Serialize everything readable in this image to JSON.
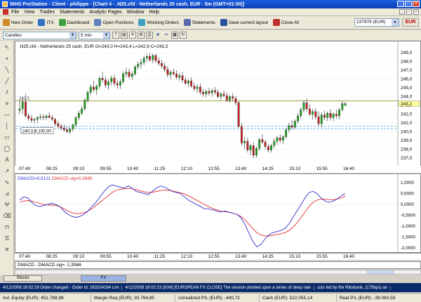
{
  "window": {
    "title": "WHS ProStation - Client - philippe - [Chart 4 - .N25.cfd - Netherlands 25 cash, EUR - 5m (GMT+01:00)]"
  },
  "menu": [
    "File",
    "View",
    "Trades",
    "Statements",
    "Analytic Pages",
    "Window",
    "Help"
  ],
  "toolbar": {
    "items": [
      {
        "label": "New Order",
        "icon": "new-order-icon",
        "color": "#d08a2a"
      },
      {
        "label": "ITX",
        "icon": "itx-icon",
        "color": "#3070c0"
      },
      {
        "label": "Dashboard",
        "icon": "dashboard-icon",
        "color": "#40a040"
      },
      {
        "label": "Open Positions",
        "icon": "open-positions-icon",
        "color": "#6080c0"
      },
      {
        "label": "Working Orders",
        "icon": "working-orders-icon",
        "color": "#40a0c0"
      },
      {
        "label": "Statements",
        "icon": "statements-icon",
        "color": "#5a6ab0"
      },
      {
        "label": "Save current layout",
        "icon": "save-layout-icon",
        "color": "#2a50a0"
      },
      {
        "label": "Close All",
        "icon": "close-all-icon",
        "color": "#c03030"
      }
    ],
    "account": "237979 (EUR)",
    "currency": "EUR"
  },
  "chart_toolbar": {
    "chart_type": "Candles",
    "interval": "5 min"
  },
  "chart_data": {
    "type": "candlestick",
    "header": ".N25.cfd - Netherlands 25 cash, EUR O=243,0 H=243,4 L=242,9 C=243,2",
    "price_axis": [
      "249,0",
      "248,0",
      "247,0",
      "246,0",
      "245,0",
      "244,0",
      "243,0",
      "242,0",
      "241,0",
      "240,0",
      "239,0",
      "238,0",
      "237,0"
    ],
    "ylim": [
      236.5,
      249.5
    ],
    "current_price": "243,2",
    "horizontal_lines": [
      243.5,
      240.6,
      240.3
    ],
    "line_label_left": "243,5",
    "order_label": "240,3,B,100,00",
    "x_ticks": [
      "07:40",
      "08:25",
      "09:10",
      "09:55",
      "10:40",
      "11:25",
      "12:10",
      "12:55",
      "13:40",
      "14:25",
      "15:10",
      "15:55",
      "16:40"
    ],
    "candles": [
      [
        242.4,
        243.7,
        242.0,
        242.6
      ],
      [
        242.6,
        243.9,
        242.0,
        243.4
      ],
      [
        243.4,
        244.3,
        241.6,
        241.8
      ],
      [
        241.8,
        242.1,
        241.2,
        241.5
      ],
      [
        241.5,
        241.9,
        241.0,
        241.3
      ],
      [
        241.3,
        241.6,
        240.9,
        241.4
      ],
      [
        241.4,
        241.8,
        241.0,
        241.6
      ],
      [
        241.6,
        242.0,
        241.3,
        241.7
      ],
      [
        241.7,
        242.0,
        241.3,
        241.6
      ],
      [
        241.6,
        241.9,
        241.3,
        241.8
      ],
      [
        241.8,
        242.2,
        241.5,
        241.6
      ],
      [
        241.6,
        241.9,
        241.2,
        241.4
      ],
      [
        241.4,
        241.6,
        240.7,
        240.9
      ],
      [
        240.9,
        241.2,
        240.4,
        240.6
      ],
      [
        240.6,
        240.9,
        240.2,
        240.4
      ],
      [
        240.4,
        240.8,
        240.0,
        240.2
      ],
      [
        240.2,
        240.6,
        239.8,
        240.0
      ],
      [
        240.0,
        240.5,
        239.7,
        240.3
      ],
      [
        240.3,
        240.9,
        240.0,
        240.8
      ],
      [
        240.8,
        241.8,
        240.5,
        241.6
      ],
      [
        241.6,
        242.4,
        241.3,
        242.1
      ],
      [
        242.1,
        242.9,
        241.9,
        242.6
      ],
      [
        242.6,
        243.8,
        242.4,
        243.6
      ],
      [
        243.6,
        244.7,
        243.3,
        244.5
      ],
      [
        244.5,
        245.4,
        244.2,
        245.1
      ],
      [
        245.1,
        245.8,
        244.5,
        244.8
      ],
      [
        244.8,
        245.4,
        244.2,
        245.2
      ],
      [
        245.2,
        246.3,
        244.9,
        246.1
      ],
      [
        246.1,
        246.8,
        245.6,
        245.9
      ],
      [
        245.9,
        246.3,
        245.0,
        245.3
      ],
      [
        245.3,
        246.0,
        244.8,
        245.7
      ],
      [
        245.7,
        246.4,
        245.3,
        246.1
      ],
      [
        246.1,
        246.5,
        245.2,
        245.5
      ],
      [
        245.5,
        245.9,
        244.9,
        245.3
      ],
      [
        245.3,
        246.0,
        244.9,
        245.7
      ],
      [
        245.7,
        246.9,
        245.5,
        246.6
      ],
      [
        246.6,
        247.3,
        246.2,
        246.8
      ],
      [
        246.8,
        247.2,
        246.0,
        246.3
      ],
      [
        246.3,
        246.9,
        245.9,
        246.6
      ],
      [
        246.6,
        247.6,
        246.4,
        247.4
      ],
      [
        247.4,
        248.0,
        247.1,
        247.7
      ],
      [
        247.7,
        248.3,
        247.2,
        247.9
      ],
      [
        247.9,
        248.7,
        247.6,
        248.4
      ],
      [
        248.4,
        248.9,
        248.0,
        248.6
      ],
      [
        248.6,
        249.0,
        248.0,
        248.2
      ],
      [
        248.2,
        248.9,
        247.8,
        248.7
      ],
      [
        248.7,
        248.9,
        247.9,
        248.1
      ],
      [
        248.1,
        248.5,
        247.5,
        247.8
      ],
      [
        247.8,
        248.2,
        247.2,
        247.5
      ],
      [
        247.5,
        247.9,
        246.8,
        247.1
      ],
      [
        247.1,
        247.5,
        246.2,
        246.5
      ],
      [
        246.5,
        247.0,
        246.0,
        246.8
      ],
      [
        246.8,
        247.2,
        246.4,
        246.6
      ],
      [
        246.6,
        247.0,
        246.0,
        246.2
      ],
      [
        246.2,
        246.7,
        245.8,
        246.4
      ],
      [
        246.4,
        246.8,
        245.6,
        245.9
      ],
      [
        245.9,
        246.3,
        245.3,
        245.5
      ],
      [
        245.5,
        246.0,
        245.1,
        245.8
      ],
      [
        245.8,
        246.2,
        245.0,
        245.2
      ],
      [
        245.2,
        245.6,
        244.6,
        244.9
      ],
      [
        244.9,
        245.4,
        244.4,
        245.1
      ],
      [
        245.1,
        245.5,
        244.2,
        244.5
      ],
      [
        244.5,
        244.9,
        244.0,
        244.3
      ],
      [
        244.3,
        244.8,
        243.9,
        244.6
      ],
      [
        244.6,
        245.0,
        244.1,
        244.4
      ],
      [
        244.4,
        244.9,
        244.0,
        244.7
      ],
      [
        244.7,
        245.1,
        244.2,
        244.5
      ],
      [
        244.5,
        244.8,
        243.8,
        244.0
      ],
      [
        244.0,
        244.5,
        243.6,
        244.3
      ],
      [
        244.3,
        244.7,
        243.9,
        244.1
      ],
      [
        244.1,
        244.5,
        243.4,
        243.6
      ],
      [
        243.6,
        244.2,
        243.3,
        244.0
      ],
      [
        244.0,
        244.4,
        243.5,
        243.8
      ],
      [
        243.8,
        244.1,
        243.0,
        243.3
      ],
      [
        243.3,
        243.5,
        240.4,
        240.6
      ],
      [
        240.6,
        241.0,
        238.4,
        238.7
      ],
      [
        238.7,
        239.4,
        238.0,
        238.9
      ],
      [
        238.9,
        239.3,
        237.6,
        237.9
      ],
      [
        237.9,
        238.6,
        237.3,
        238.4
      ],
      [
        238.4,
        238.8,
        237.0,
        237.3
      ],
      [
        237.3,
        238.3,
        237.0,
        238.1
      ],
      [
        238.1,
        239.3,
        237.8,
        239.1
      ],
      [
        239.1,
        239.7,
        238.6,
        238.8
      ],
      [
        238.8,
        239.1,
        238.0,
        238.3
      ],
      [
        238.3,
        238.6,
        237.6,
        237.9
      ],
      [
        237.9,
        238.6,
        237.6,
        238.4
      ],
      [
        238.4,
        239.2,
        238.1,
        238.9
      ],
      [
        238.9,
        239.5,
        238.5,
        239.3
      ],
      [
        239.3,
        239.7,
        238.7,
        239.0
      ],
      [
        239.0,
        239.6,
        238.6,
        239.4
      ],
      [
        239.4,
        240.4,
        239.2,
        240.2
      ],
      [
        240.2,
        241.0,
        239.9,
        240.7
      ],
      [
        240.7,
        241.3,
        240.2,
        240.5
      ],
      [
        240.5,
        241.4,
        240.3,
        241.2
      ],
      [
        241.2,
        242.1,
        240.9,
        241.8
      ],
      [
        241.8,
        242.8,
        241.5,
        242.5
      ],
      [
        242.5,
        243.6,
        242.2,
        243.3
      ],
      [
        243.3,
        243.8,
        242.3,
        242.6
      ],
      [
        242.6,
        243.1,
        241.8,
        242.0
      ],
      [
        242.0,
        242.6,
        241.4,
        242.3
      ],
      [
        242.3,
        242.7,
        241.4,
        241.7
      ],
      [
        241.7,
        242.3,
        240.6,
        240.9
      ],
      [
        240.9,
        242.2,
        240.5,
        241.9
      ],
      [
        241.9,
        242.4,
        241.3,
        241.6
      ],
      [
        241.6,
        242.3,
        241.2,
        242.1
      ],
      [
        242.1,
        242.6,
        241.3,
        241.6
      ],
      [
        241.6,
        242.2,
        241.2,
        242.0
      ],
      [
        242.0,
        242.5,
        241.5,
        241.8
      ],
      [
        241.8,
        242.7,
        241.4,
        242.5
      ],
      [
        242.5,
        243.5,
        242.3,
        243.2
      ],
      [
        243.0,
        243.4,
        242.9,
        243.2
      ]
    ],
    "macd_label": "DMACD=0,5121",
    "signal_label": "DMACD sig=0,3866",
    "macd_axis": [
      "1,0000",
      "0,5000",
      "0,0000",
      "-0,5000",
      "-1,0000",
      "-1,5000",
      "-2,0000"
    ],
    "macd_ylim": [
      -2.1,
      1.2
    ],
    "macd_line": [
      0.2,
      0.35,
      0.3,
      0.1,
      -0.05,
      -0.1,
      -0.05,
      0.0,
      0.05,
      0.0,
      -0.1,
      -0.3,
      -0.45,
      -0.55,
      -0.6,
      -0.55,
      -0.45,
      -0.3,
      -0.1,
      0.1,
      0.35,
      0.6,
      0.8,
      0.9,
      0.85,
      0.8,
      0.75,
      0.85,
      0.75,
      0.6,
      0.55,
      0.5,
      0.45,
      0.6,
      0.75,
      0.85,
      0.8,
      0.7,
      0.6,
      0.55,
      0.5,
      0.35,
      0.2,
      0.1,
      0.0,
      -0.1,
      -0.2,
      -0.2,
      -0.25,
      -0.3,
      -0.35,
      -0.3,
      -0.35,
      -0.4,
      -0.45,
      -0.6,
      -0.9,
      -1.3,
      -1.7,
      -1.95,
      -1.85,
      -1.6,
      -1.4,
      -1.3,
      -1.25,
      -1.2,
      -1.1,
      -0.9,
      -0.6,
      -0.3,
      0.0,
      0.3,
      0.55,
      0.6,
      0.5,
      0.3,
      0.15,
      0.1,
      0.15,
      0.25,
      0.4,
      0.5
    ],
    "signal_line": [
      0.1,
      0.15,
      0.18,
      0.15,
      0.1,
      0.05,
      0.0,
      -0.02,
      -0.03,
      -0.05,
      -0.1,
      -0.2,
      -0.3,
      -0.38,
      -0.42,
      -0.42,
      -0.38,
      -0.3,
      -0.2,
      -0.05,
      0.1,
      0.25,
      0.4,
      0.55,
      0.65,
      0.7,
      0.72,
      0.74,
      0.72,
      0.68,
      0.63,
      0.58,
      0.55,
      0.56,
      0.6,
      0.64,
      0.66,
      0.65,
      0.62,
      0.58,
      0.54,
      0.48,
      0.4,
      0.3,
      0.2,
      0.1,
      0.0,
      -0.1,
      -0.18,
      -0.25,
      -0.3,
      -0.33,
      -0.36,
      -0.4,
      -0.45,
      -0.55,
      -0.7,
      -0.9,
      -1.1,
      -1.3,
      -1.4,
      -1.45,
      -1.45,
      -1.42,
      -1.38,
      -1.35,
      -1.3,
      -1.2,
      -1.05,
      -0.85,
      -0.6,
      -0.35,
      -0.1,
      0.1,
      0.2,
      0.25,
      0.25,
      0.22,
      0.22,
      0.25,
      0.3,
      0.38
    ]
  },
  "indicator_bar": {
    "label": "DMACD - DMACD sig=",
    "value": "-1,9566"
  },
  "tabs": [
    {
      "label": "Stocks",
      "active": false
    },
    {
      "label": "FX",
      "active": true
    }
  ],
  "news": [
    "4/12/2008 16:02:29 Order changed - Order Id: 163104164 Lim",
    "4/12/2008 16:02:23 [IGM] [EUROPEAN FX CLOSE] The session pivoted upon a series of deep rate",
    "cuts led by the Riksbank, (175bps) an"
  ],
  "status": {
    "equity_label": "Avl. Equity (EUR):",
    "equity_value": "451.788,98",
    "margin_label": "Margin Req (EUR):",
    "margin_value": "30.764,85",
    "unreal_label": "Unrealized P/L (EUR):",
    "unreal_value": "-440,72",
    "cash_label": "Cash (EUR):",
    "cash_value": "522.055,14",
    "real_label": "Real P/L (EUR):",
    "real_value": "-39.060,59"
  },
  "colors": {
    "macd": "#3030d0",
    "signal": "#e03030",
    "candle_up": "#20a020",
    "candle_down": "#c02020",
    "hline": "#7a7a00",
    "dashed": "#3f9fd8"
  }
}
